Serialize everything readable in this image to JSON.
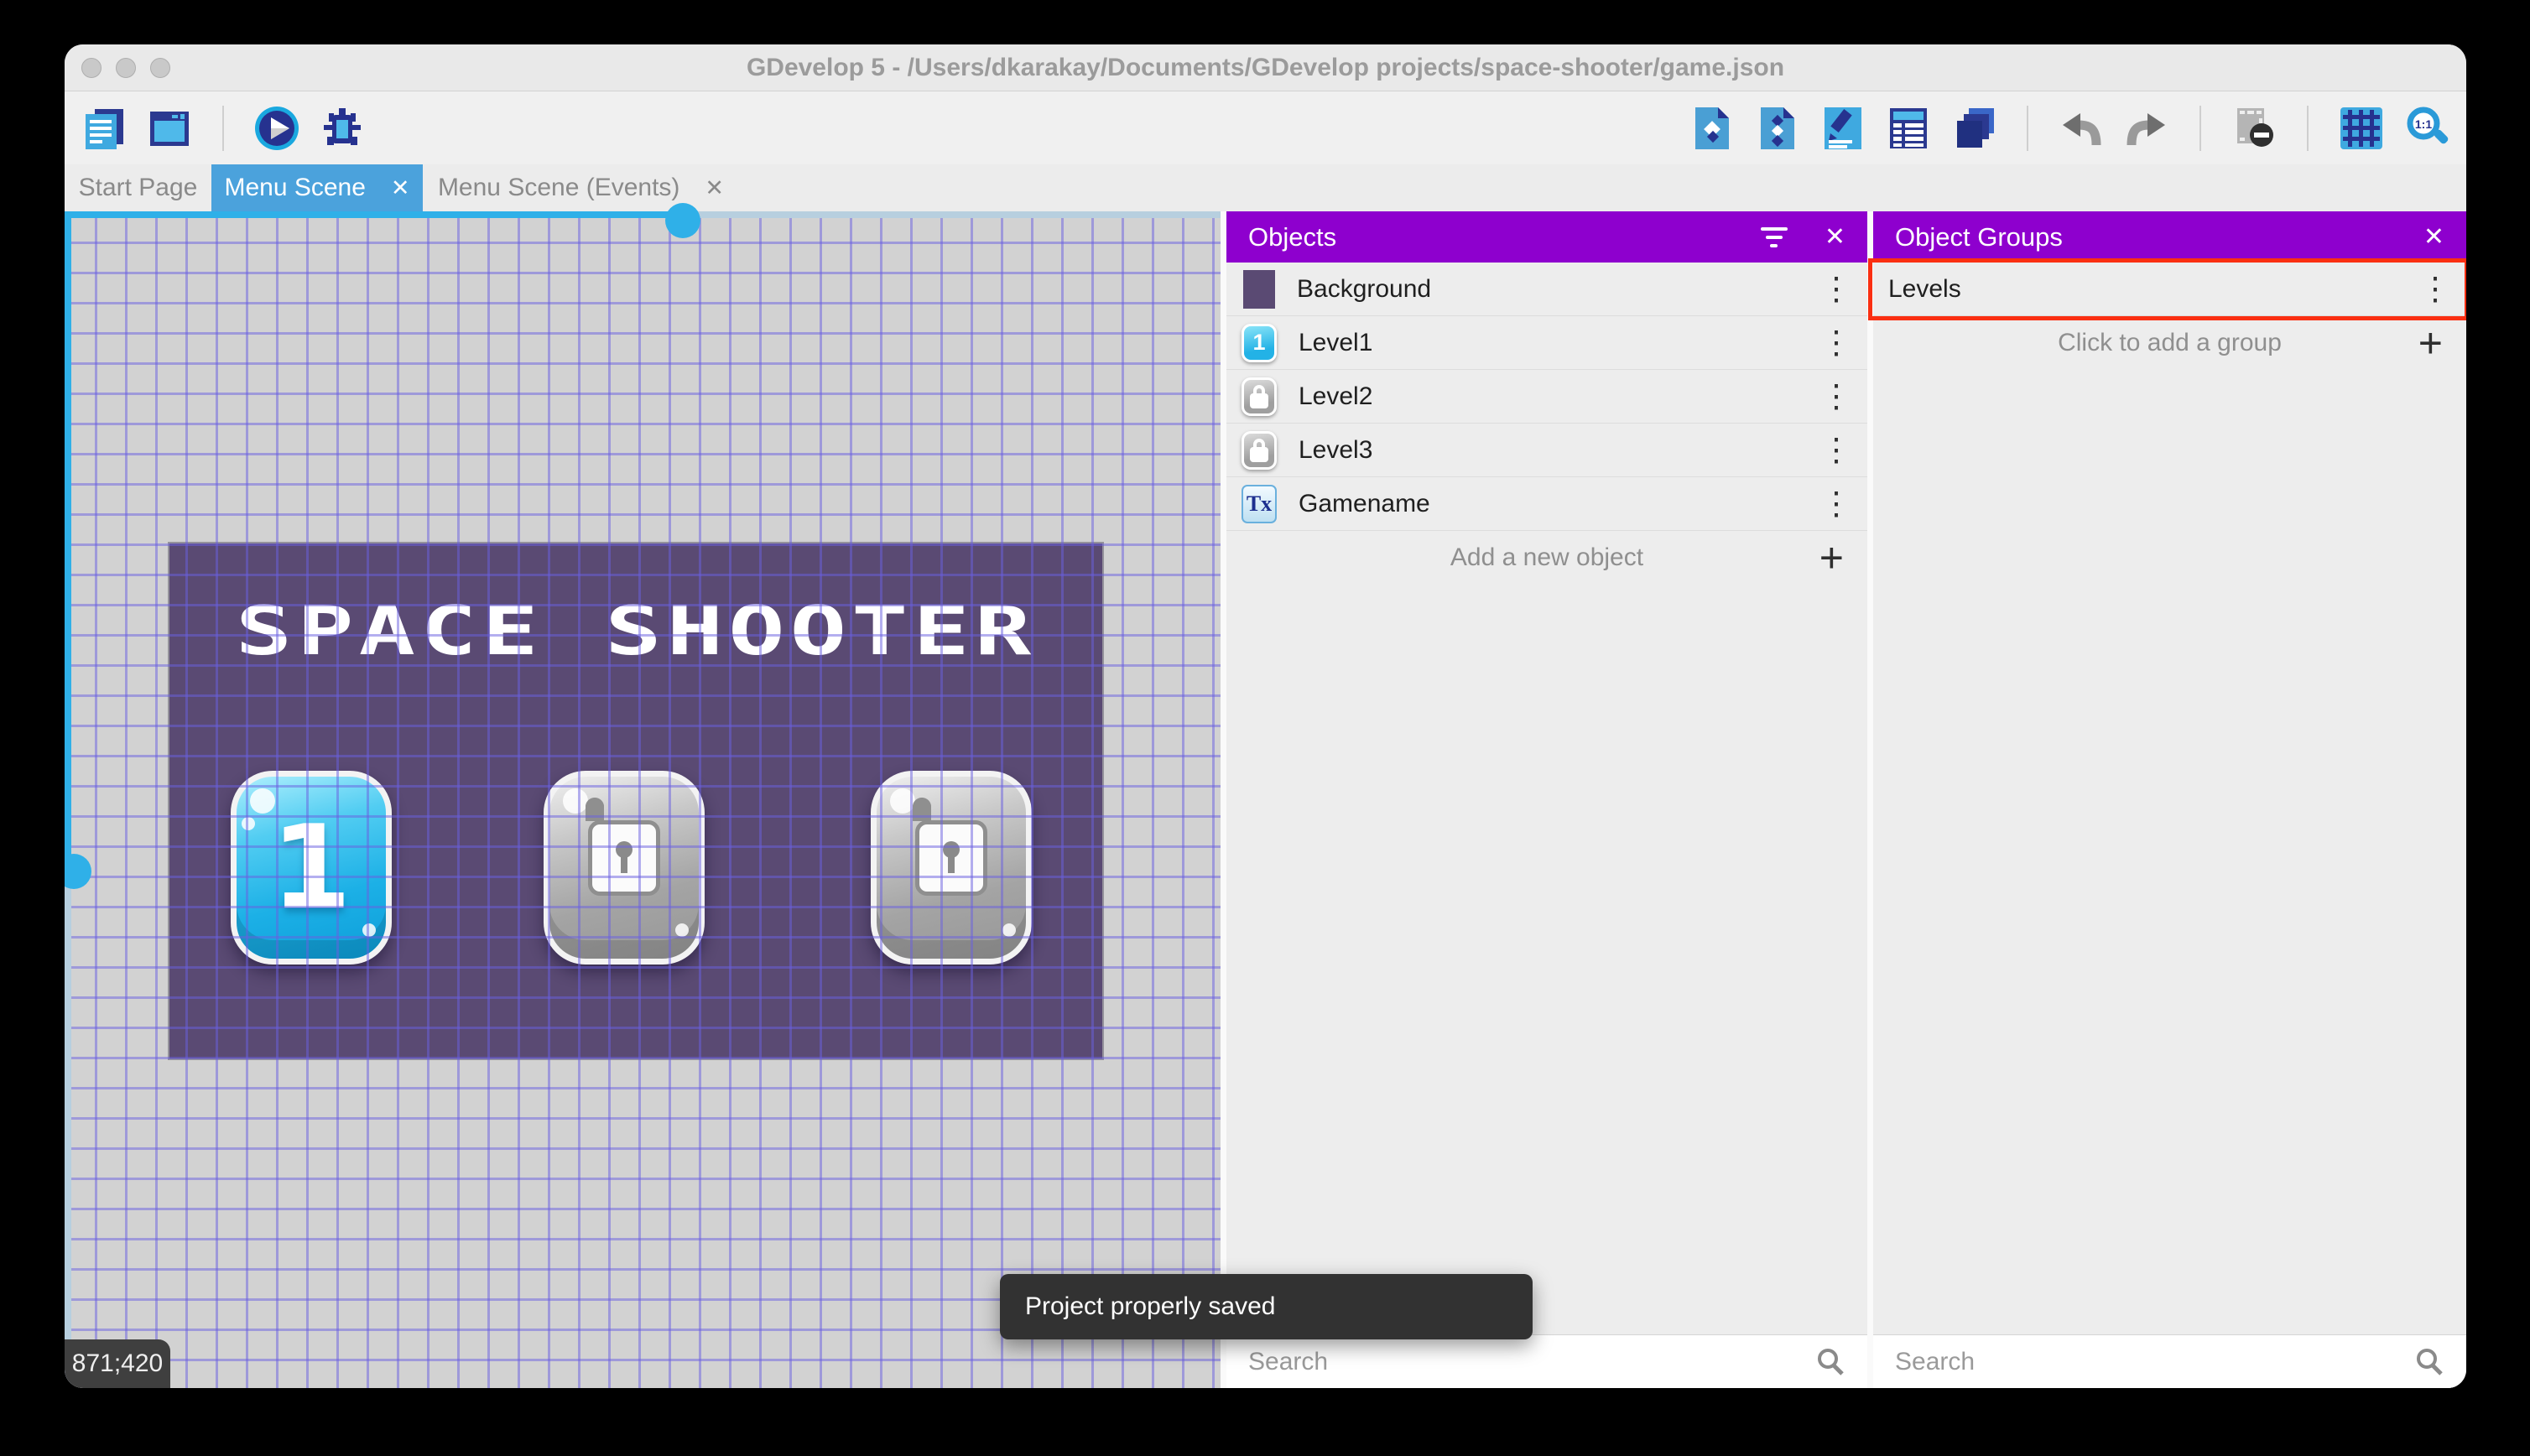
{
  "window": {
    "title": "GDevelop 5 - /Users/dkarakay/Documents/GDevelop projects/space-shooter/game.json"
  },
  "toolbar": {
    "left_icons": [
      "project-manager",
      "scene-editor-window",
      "preview-play",
      "debug"
    ],
    "right_icons": [
      "objects-editor",
      "object-groups-editor",
      "properties",
      "instances-list",
      "layers",
      "undo",
      "redo",
      "toggle-window-mask",
      "toggle-grid",
      "zoom-original"
    ],
    "zoom_label": "1:1"
  },
  "tabs": [
    {
      "label": "Start Page",
      "active": false,
      "closable": false
    },
    {
      "label": "Menu Scene",
      "active": true,
      "closable": true
    },
    {
      "label": "Menu Scene (Events)",
      "active": false,
      "closable": true
    }
  ],
  "glyphs": {
    "close": "✕",
    "kebab": "⋮",
    "plus": "+"
  },
  "canvas": {
    "coordinates": "871;420",
    "scene": {
      "title": "SPACE SHOOTER",
      "level_buttons": [
        {
          "label": "1",
          "state": "unlocked"
        },
        {
          "state": "locked"
        },
        {
          "state": "locked"
        }
      ]
    }
  },
  "objects_panel": {
    "title": "Objects",
    "items": [
      {
        "label": "Background",
        "thumb": "color-swatch"
      },
      {
        "label": "Level1",
        "thumb": "blue-button",
        "thumb_char": "1"
      },
      {
        "label": "Level2",
        "thumb": "locked-button"
      },
      {
        "label": "Level3",
        "thumb": "locked-button"
      },
      {
        "label": "Gamename",
        "thumb": "text-object",
        "thumb_char": "Tx"
      }
    ],
    "add_label": "Add a new object",
    "search_placeholder": "Search"
  },
  "object_groups_panel": {
    "title": "Object Groups",
    "groups": [
      {
        "label": "Levels",
        "highlighted": true
      }
    ],
    "add_label": "Click to add a group",
    "search_placeholder": "Search"
  },
  "toast": {
    "message": "Project properly saved"
  },
  "colors": {
    "panel_header": "#8E00CE",
    "active_tab": "#4BA2DC",
    "highlight_red": "#FA2F12",
    "game_background": "#5A4A73",
    "grid_line": "#6A60E0",
    "scrollbar": "#2FB0E8",
    "toast_background": "#323232"
  }
}
